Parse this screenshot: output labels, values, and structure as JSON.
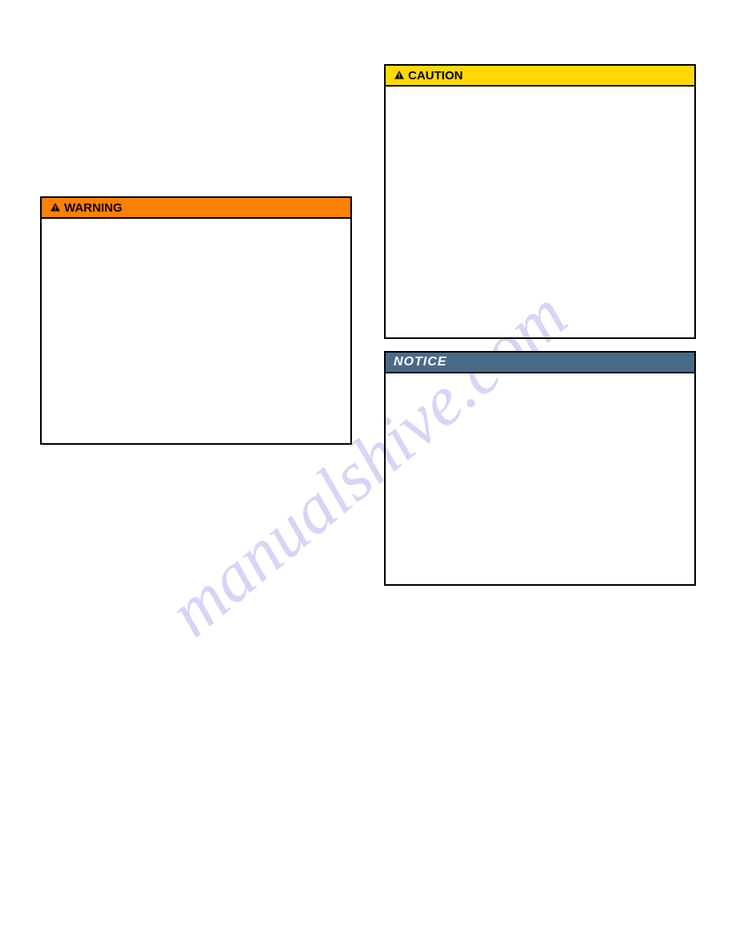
{
  "watermark": "manualshive.com",
  "boxes": {
    "warning": {
      "label": "WARNING"
    },
    "caution": {
      "label": "CAUTION"
    },
    "notice": {
      "label": "NOTICE"
    }
  }
}
